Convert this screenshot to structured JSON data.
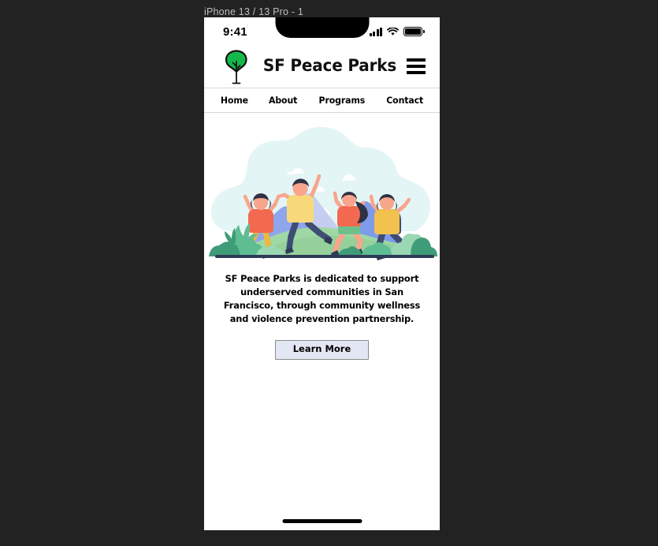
{
  "simulator": {
    "device_label": "iPhone 13 / 13 Pro - 1",
    "background_color": "#222222"
  },
  "status_bar": {
    "time": "9:41",
    "icons": [
      "cellular-signal-icon",
      "wifi-icon",
      "battery-icon"
    ]
  },
  "header": {
    "logo_icon": "tree-logo-icon",
    "brand_title": "SF Peace Parks",
    "menu_icon": "hamburger-menu-icon"
  },
  "nav": {
    "items": [
      {
        "label": "Home"
      },
      {
        "label": "About"
      },
      {
        "label": "Programs"
      },
      {
        "label": "Contact"
      }
    ]
  },
  "hero": {
    "illustration_name": "children-jumping-on-hill-illustration",
    "alt": "Four children jumping joyfully on a green hill with blue mountains and bushes",
    "colors": {
      "sky_blob": "#e4f5f6",
      "cloud": "#ffffff",
      "mountain_back": "#c5cdf0",
      "mountain_front": "#7e9bea",
      "hill": "#9fd8a4",
      "hill_shadow": "#8ccb94",
      "bush_dark": "#3f9c78",
      "bush_mid": "#5fbd93",
      "bush_light": "#9ad8b4",
      "ground_line": "#2f3a56",
      "shirt_coral": "#f2694f",
      "shirt_yellow": "#f8d979",
      "shirt_mustard": "#f2c14e",
      "pants_navy": "#3f4d75",
      "pants_yellow": "#f0b63f",
      "shorts_green": "#6ec08a",
      "skin": "#f8a58c",
      "hair_dark": "#2f3243",
      "shoe": "#2f3a56"
    }
  },
  "content": {
    "tagline": "SF Peace Parks is dedicated to support underserved communities in San Francisco, through community wellness and violence prevention partnership.",
    "cta_label": "Learn More",
    "cta_bg": "#e3e6f3",
    "cta_border": "#8b8b8b"
  },
  "footer": {
    "home_indicator": "home-indicator-bar"
  }
}
